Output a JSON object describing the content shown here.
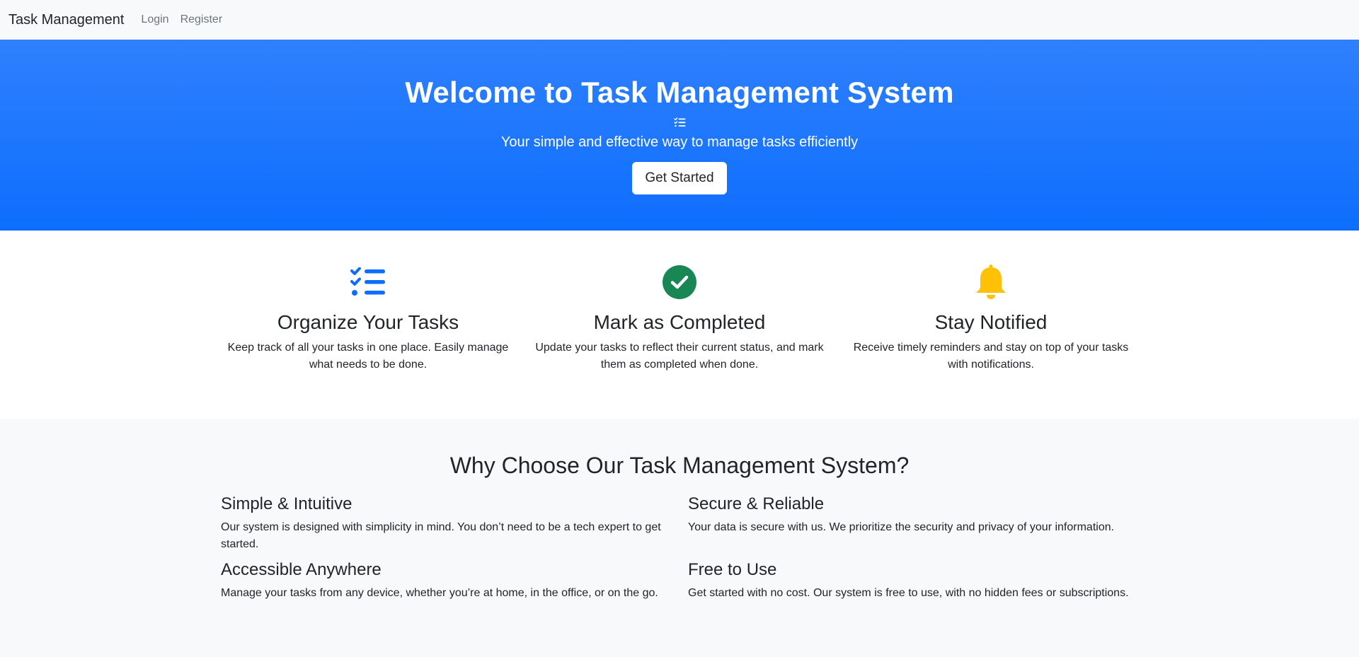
{
  "navbar": {
    "brand": "Task Management",
    "links": [
      {
        "label": "Login"
      },
      {
        "label": "Register"
      }
    ]
  },
  "hero": {
    "title": "Welcome to Task Management System",
    "icon": "list-check-icon",
    "subtitle": "Your simple and effective way to manage tasks efficiently",
    "button_label": "Get Started",
    "gradient_colors": [
      "#2f80fd",
      "#0d6efd"
    ]
  },
  "features": [
    {
      "icon": "list-check-icon",
      "icon_color": "#0d6efd",
      "title": "Organize Your Tasks",
      "text": "Keep track of all your tasks in one place. Easily manage what needs to be done."
    },
    {
      "icon": "check-circle-icon",
      "icon_color": "#198754",
      "title": "Mark as Completed",
      "text": "Update your tasks to reflect their current status, and mark them as completed when done."
    },
    {
      "icon": "bell-icon",
      "icon_color": "#ffc107",
      "title": "Stay Notified",
      "text": "Receive timely reminders and stay on top of your tasks with notifications."
    }
  ],
  "why": {
    "title": "Why Choose Our Task Management System?",
    "items": [
      {
        "title": "Simple & Intuitive",
        "text": "Our system is designed with simplicity in mind. You don’t need to be a tech expert to get started."
      },
      {
        "title": "Secure & Reliable",
        "text": "Your data is secure with us. We prioritize the security and privacy of your information."
      },
      {
        "title": "Accessible Anywhere",
        "text": "Manage your tasks from any device, whether you’re at home, in the office, or on the go."
      },
      {
        "title": "Free to Use",
        "text": "Get started with no cost. Our system is free to use, with no hidden fees or subscriptions."
      }
    ]
  }
}
